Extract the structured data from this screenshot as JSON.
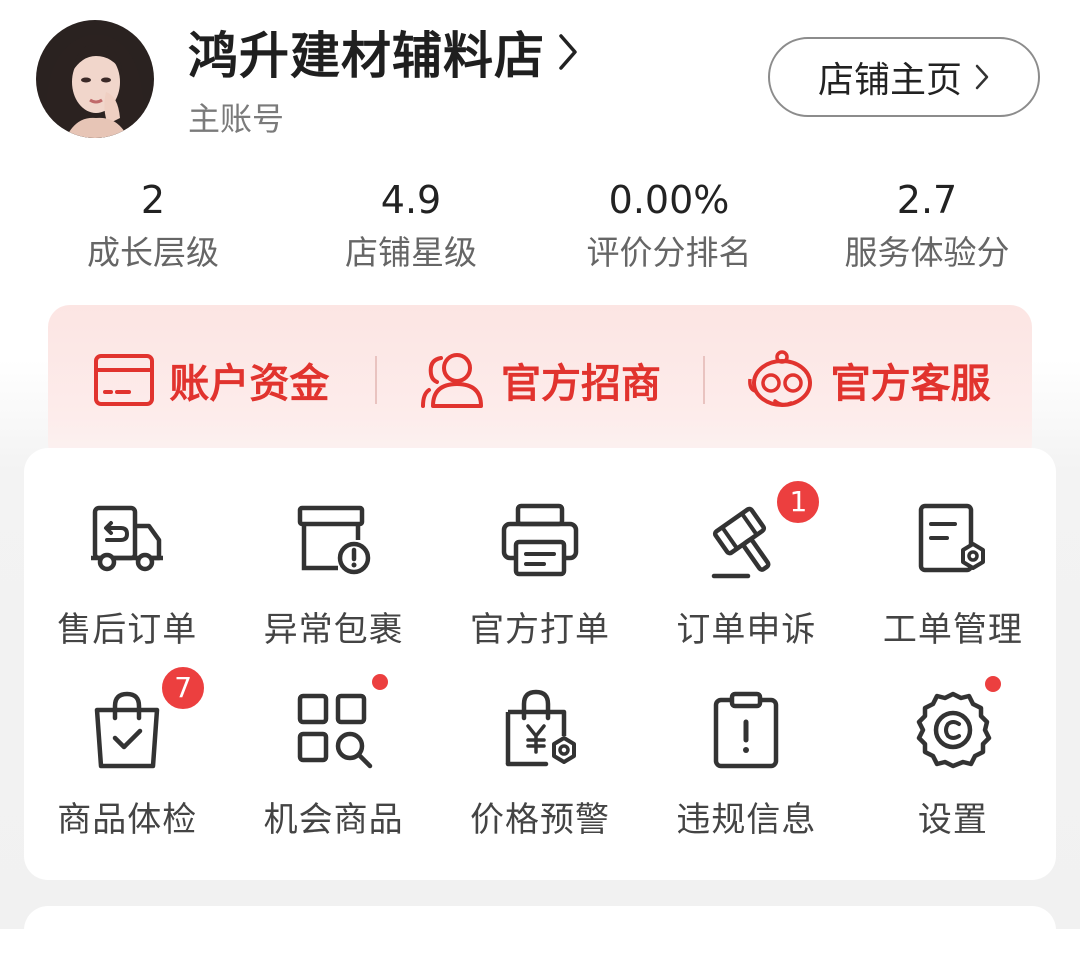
{
  "shop": {
    "name": "鸿升建材辅料店",
    "account_type": "主账号",
    "home_button": "店铺主页"
  },
  "stats": [
    {
      "value": "2",
      "label": "成长层级"
    },
    {
      "value": "4.9",
      "label": "店铺星级"
    },
    {
      "value": "0.00%",
      "label": "评价分排名"
    },
    {
      "value": "2.7",
      "label": "服务体验分"
    }
  ],
  "shortcuts": [
    {
      "label": "账户资金",
      "icon": "wallet-card-icon"
    },
    {
      "label": "官方招商",
      "icon": "people-icon"
    },
    {
      "label": "官方客服",
      "icon": "customer-service-icon"
    }
  ],
  "tools": {
    "row1": [
      {
        "label": "售后订单",
        "icon": "return-truck-icon"
      },
      {
        "label": "异常包裹",
        "icon": "package-alert-icon"
      },
      {
        "label": "官方打单",
        "icon": "printer-icon"
      },
      {
        "label": "订单申诉",
        "icon": "gavel-icon",
        "badge": "1"
      },
      {
        "label": "工单管理",
        "icon": "ticket-gear-icon"
      }
    ],
    "row2": [
      {
        "label": "商品体检",
        "icon": "bag-check-icon",
        "badge": "7"
      },
      {
        "label": "机会商品",
        "icon": "grid-search-icon",
        "dot": true
      },
      {
        "label": "价格预警",
        "icon": "price-bag-icon"
      },
      {
        "label": "违规信息",
        "icon": "clipboard-alert-icon"
      },
      {
        "label": "设置",
        "icon": "settings-gear-icon",
        "dot": true
      }
    ]
  },
  "colors": {
    "accent": "#e1332e",
    "badge": "#ec3f3f",
    "panel_bg": "#fce5e3"
  }
}
